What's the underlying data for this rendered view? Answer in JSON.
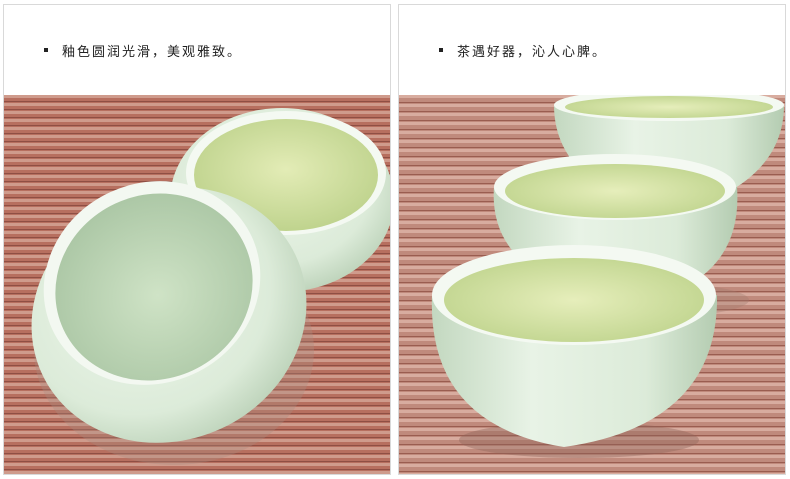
{
  "panels": [
    {
      "caption": "釉色圆润光滑，美观雅致。",
      "image": "two-celadon-tea-cups-on-bamboo-mat"
    },
    {
      "caption": "茶遇好器，沁人心脾。",
      "image": "three-celadon-tea-cups-with-green-tea"
    }
  ],
  "colors": {
    "mat": "#b76f5f",
    "mat_light": "#cf9b8c",
    "cup_glaze": "#dfeedd",
    "cup_shadow": "#b9d0b7",
    "tea": "#c9dc97"
  }
}
